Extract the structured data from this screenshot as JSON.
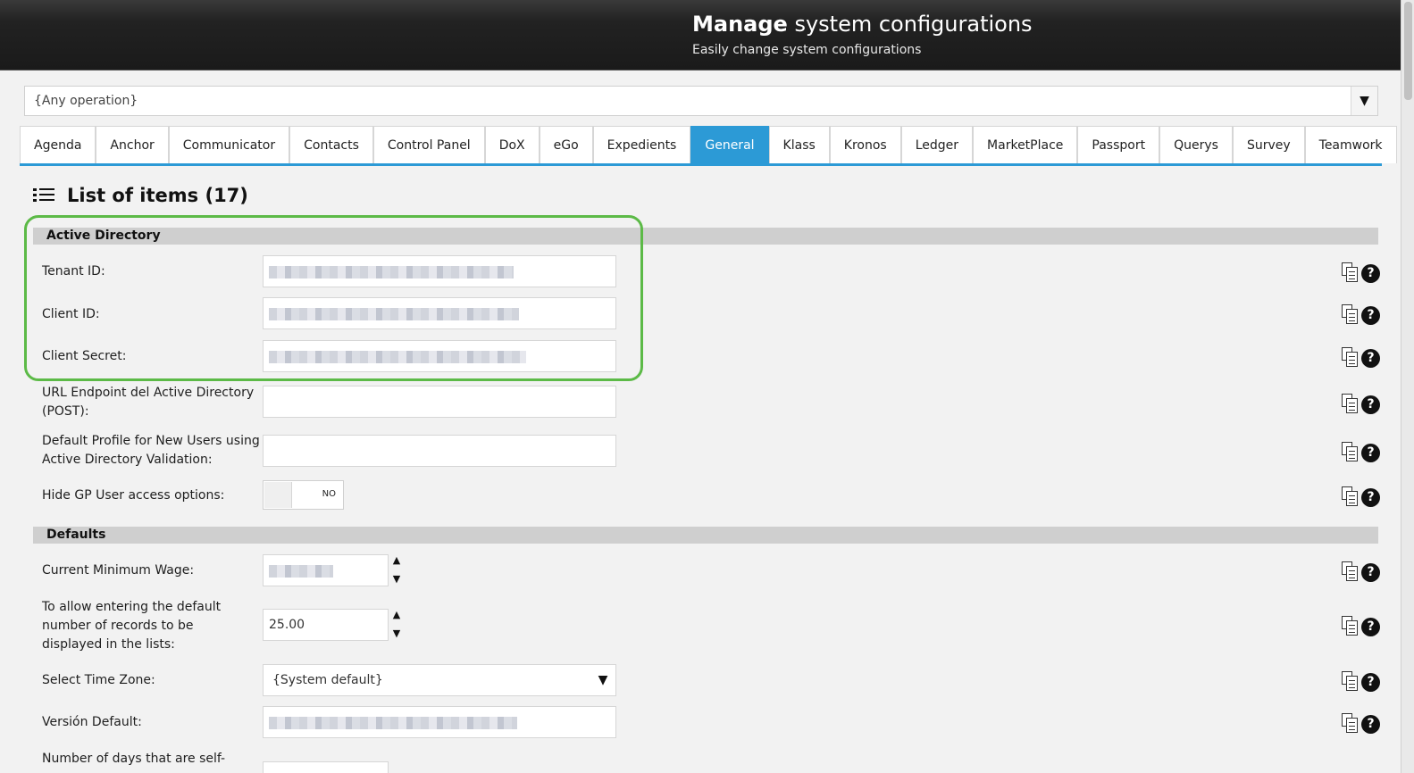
{
  "header": {
    "title_bold": "Manage",
    "title_rest": " system configurations",
    "subtitle": "Easily change system configurations"
  },
  "operation_select": {
    "value": "{Any operation}"
  },
  "tabs": [
    {
      "label": "Agenda"
    },
    {
      "label": "Anchor"
    },
    {
      "label": "Communicator"
    },
    {
      "label": "Contacts"
    },
    {
      "label": "Control Panel"
    },
    {
      "label": "DoX"
    },
    {
      "label": "eGo"
    },
    {
      "label": "Expedients"
    },
    {
      "label": "General",
      "active": true
    },
    {
      "label": "Klass"
    },
    {
      "label": "Kronos"
    },
    {
      "label": "Ledger"
    },
    {
      "label": "MarketPlace"
    },
    {
      "label": "Passport"
    },
    {
      "label": "Querys"
    },
    {
      "label": "Survey"
    },
    {
      "label": "Teamwork"
    }
  ],
  "list": {
    "title": "List of items (17)"
  },
  "sections": {
    "active_directory": {
      "title": "Active Directory",
      "tenant_id": {
        "label": "Tenant ID:"
      },
      "client_id": {
        "label": "Client ID:"
      },
      "client_secret": {
        "label": "Client Secret:"
      },
      "url_endpoint": {
        "label": "URL Endpoint del Active Directory (POST):"
      },
      "default_profile": {
        "label": "Default Profile for New Users using Active Directory Validation:"
      },
      "hide_gp": {
        "label": "Hide GP User access options:",
        "toggle_text": "NO"
      }
    },
    "defaults": {
      "title": "Defaults",
      "min_wage": {
        "label": "Current Minimum Wage:"
      },
      "records": {
        "label": "To allow entering the default number of records to be displayed in the lists:",
        "value": "25.00"
      },
      "time_zone": {
        "label": "Select Time Zone:",
        "value": "{System default}"
      },
      "version": {
        "label": "Versión Default:"
      },
      "days": {
        "label": "Number of days that are self-"
      }
    }
  },
  "icons": {
    "copy": "copy-icon",
    "help": "help-icon",
    "help_glyph": "?",
    "spin_up": "▲",
    "spin_down": "▼",
    "select_arrow": "▼"
  },
  "colors": {
    "accent": "#2c9ad6",
    "highlight": "#5cba47",
    "section_bar": "#cfcfcf"
  }
}
